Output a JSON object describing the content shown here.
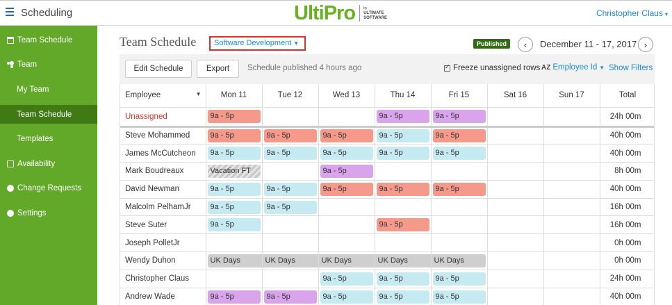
{
  "app": {
    "title": "Scheduling",
    "logo_text": "UltiPro",
    "logo_by": "by",
    "logo_sub1": "ULTIMATE",
    "logo_sub2": "SOFTWARE",
    "user": "Christopher Claus",
    "brand_color": "#62a829"
  },
  "sidebar": {
    "items": [
      {
        "label": "Team Schedule",
        "icon": "calendar-icon"
      },
      {
        "label": "Team",
        "icon": "people-icon"
      },
      {
        "label": "My Team"
      },
      {
        "label": "Team Schedule",
        "active": true
      },
      {
        "label": "Templates"
      },
      {
        "label": "Availability",
        "icon": "document-icon"
      },
      {
        "label": "Change Requests",
        "icon": "gear-icon"
      },
      {
        "label": "Settings",
        "icon": "gear-icon"
      }
    ]
  },
  "header": {
    "title": "Team Schedule",
    "department": "Software Development",
    "status_badge": "Published",
    "prev_label": "‹",
    "next_label": "›",
    "date_range": "December 11 - 17, 2017"
  },
  "toolbar": {
    "edit_label": "Edit Schedule",
    "export_label": "Export",
    "status_text": "Schedule published 4 hours ago",
    "freeze_label": "Freeze unassigned rows",
    "sort_label": "Employee Id",
    "sort_icon": "AZ",
    "filters_label": "Show Filters"
  },
  "grid": {
    "columns": [
      "Employee",
      "Mon 11",
      "Tue 12",
      "Wed 13",
      "Thu 14",
      "Fri 15",
      "Sat 16",
      "Sun 17",
      "Total"
    ],
    "rows": [
      {
        "employee": "Unassigned",
        "unassigned": true,
        "shifts": [
          {
            "label": "9a - 5p",
            "color": "red"
          },
          null,
          null,
          {
            "label": "9a - 5p",
            "color": "purple"
          },
          {
            "label": "9a - 5p",
            "color": "purple"
          },
          null,
          null
        ],
        "total": "24h 00m"
      },
      {
        "employee": "Steve Mohammed",
        "shifts": [
          {
            "label": "9a - 5p",
            "color": "red"
          },
          {
            "label": "9a - 5p",
            "color": "red"
          },
          {
            "label": "9a - 5p",
            "color": "red"
          },
          {
            "label": "9a - 5p",
            "color": "blue"
          },
          {
            "label": "9a - 5p",
            "color": "red"
          },
          null,
          null
        ],
        "total": "40h 00m"
      },
      {
        "employee": "James McCutcheon",
        "shifts": [
          {
            "label": "9a - 5p",
            "color": "blue"
          },
          {
            "label": "9a - 5p",
            "color": "blue"
          },
          {
            "label": "9a - 5p",
            "color": "blue"
          },
          {
            "label": "9a - 5p",
            "color": "blue"
          },
          {
            "label": "9a - 5p",
            "color": "blue"
          },
          null,
          null
        ],
        "total": "40h 00m"
      },
      {
        "employee": "Mark Boudreaux",
        "shifts": [
          {
            "label": "Vacation FT",
            "color": "hatch"
          },
          null,
          {
            "label": "9a - 5p",
            "color": "purple"
          },
          null,
          null,
          null,
          null
        ],
        "total": "8h 00m"
      },
      {
        "employee": "David Newman",
        "shifts": [
          {
            "label": "9a - 5p",
            "color": "blue"
          },
          {
            "label": "9a - 5p",
            "color": "blue"
          },
          {
            "label": "9a - 5p",
            "color": "red"
          },
          {
            "label": "9a - 5p",
            "color": "red"
          },
          {
            "label": "9a - 5p",
            "color": "red"
          },
          null,
          null
        ],
        "total": "40h 00m"
      },
      {
        "employee": "Malcolm PelhamJr",
        "shifts": [
          {
            "label": "9a - 5p",
            "color": "blue"
          },
          {
            "label": "9a - 5p",
            "color": "blue"
          },
          null,
          null,
          null,
          null,
          null
        ],
        "total": "16h 00m"
      },
      {
        "employee": "Steve Suter",
        "shifts": [
          {
            "label": "9a - 5p",
            "color": "blue"
          },
          null,
          null,
          {
            "label": "9a - 5p",
            "color": "red"
          },
          null,
          null,
          null
        ],
        "total": "16h 00m"
      },
      {
        "employee": "Joseph PolletJr",
        "shifts": [
          null,
          null,
          null,
          null,
          null,
          null,
          null
        ],
        "total": "0h 00m"
      },
      {
        "employee": "Wendy Duhon",
        "shifts": [
          {
            "label": "UK Days",
            "color": "grey"
          },
          {
            "label": "UK Days",
            "color": "grey"
          },
          {
            "label": "UK Days",
            "color": "grey"
          },
          {
            "label": "UK Days",
            "color": "grey"
          },
          {
            "label": "UK Days",
            "color": "grey"
          },
          null,
          null
        ],
        "total": "0h 00m"
      },
      {
        "employee": "Christopher Claus",
        "shifts": [
          null,
          null,
          {
            "label": "9a - 5p",
            "color": "blue"
          },
          {
            "label": "9a - 5p",
            "color": "blue"
          },
          {
            "label": "9a - 5p",
            "color": "blue"
          },
          null,
          null
        ],
        "total": "24h 00m"
      },
      {
        "employee": "Andrew Wade",
        "shifts": [
          {
            "label": "9a - 5p",
            "color": "purple"
          },
          {
            "label": "9a - 5p",
            "color": "purple"
          },
          {
            "label": "9a - 5p",
            "color": "blue"
          },
          {
            "label": "9a - 5p",
            "color": "blue"
          },
          {
            "label": "9a - 5p",
            "color": "blue"
          },
          null,
          null
        ],
        "total": "40h 00m"
      }
    ]
  }
}
